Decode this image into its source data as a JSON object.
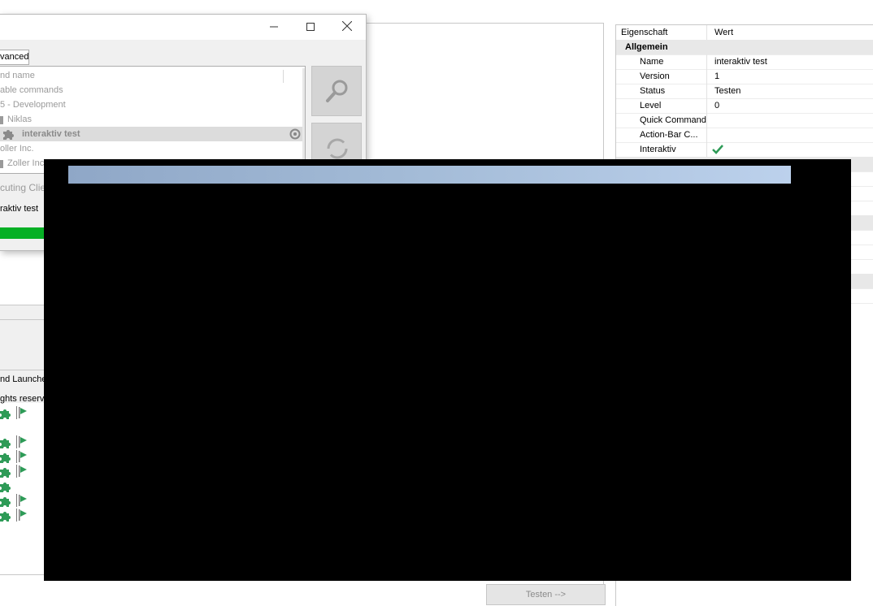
{
  "dialog": {
    "tab_label": "vanced",
    "tree_rows": [
      {
        "label": "nd name"
      },
      {
        "label": "able commands"
      },
      {
        "label": "5 - Development"
      },
      {
        "label": "Niklas"
      },
      {
        "label": "interaktiv test"
      },
      {
        "label": "oller Inc."
      },
      {
        "label": "Zoller Inc"
      },
      {
        "label": "Zoller Inc"
      }
    ],
    "executing_label": "cuting Clie",
    "executing_name": "raktiv test",
    "progress_fraction": 1.0
  },
  "left_panel": {
    "launcher_label": "nd Launche",
    "rights_label": "ghts reserv"
  },
  "buttons": {
    "test_label": "Testen -->"
  },
  "properties": {
    "header_key": "Eigenschaft",
    "header_value": "Wert",
    "category": "Allgemein",
    "rows": [
      {
        "key": "Name",
        "value": "interaktiv test"
      },
      {
        "key": "Version",
        "value": "1"
      },
      {
        "key": "Status",
        "value": "Testen"
      },
      {
        "key": "Level",
        "value": "0"
      },
      {
        "key": "Quick Command",
        "value": ""
      },
      {
        "key": "Action-Bar C...",
        "value": ""
      },
      {
        "key": "Interaktiv",
        "value": ""
      }
    ]
  },
  "colors": {
    "accent_green": "#2e9b57",
    "progress_green": "#06b025"
  }
}
